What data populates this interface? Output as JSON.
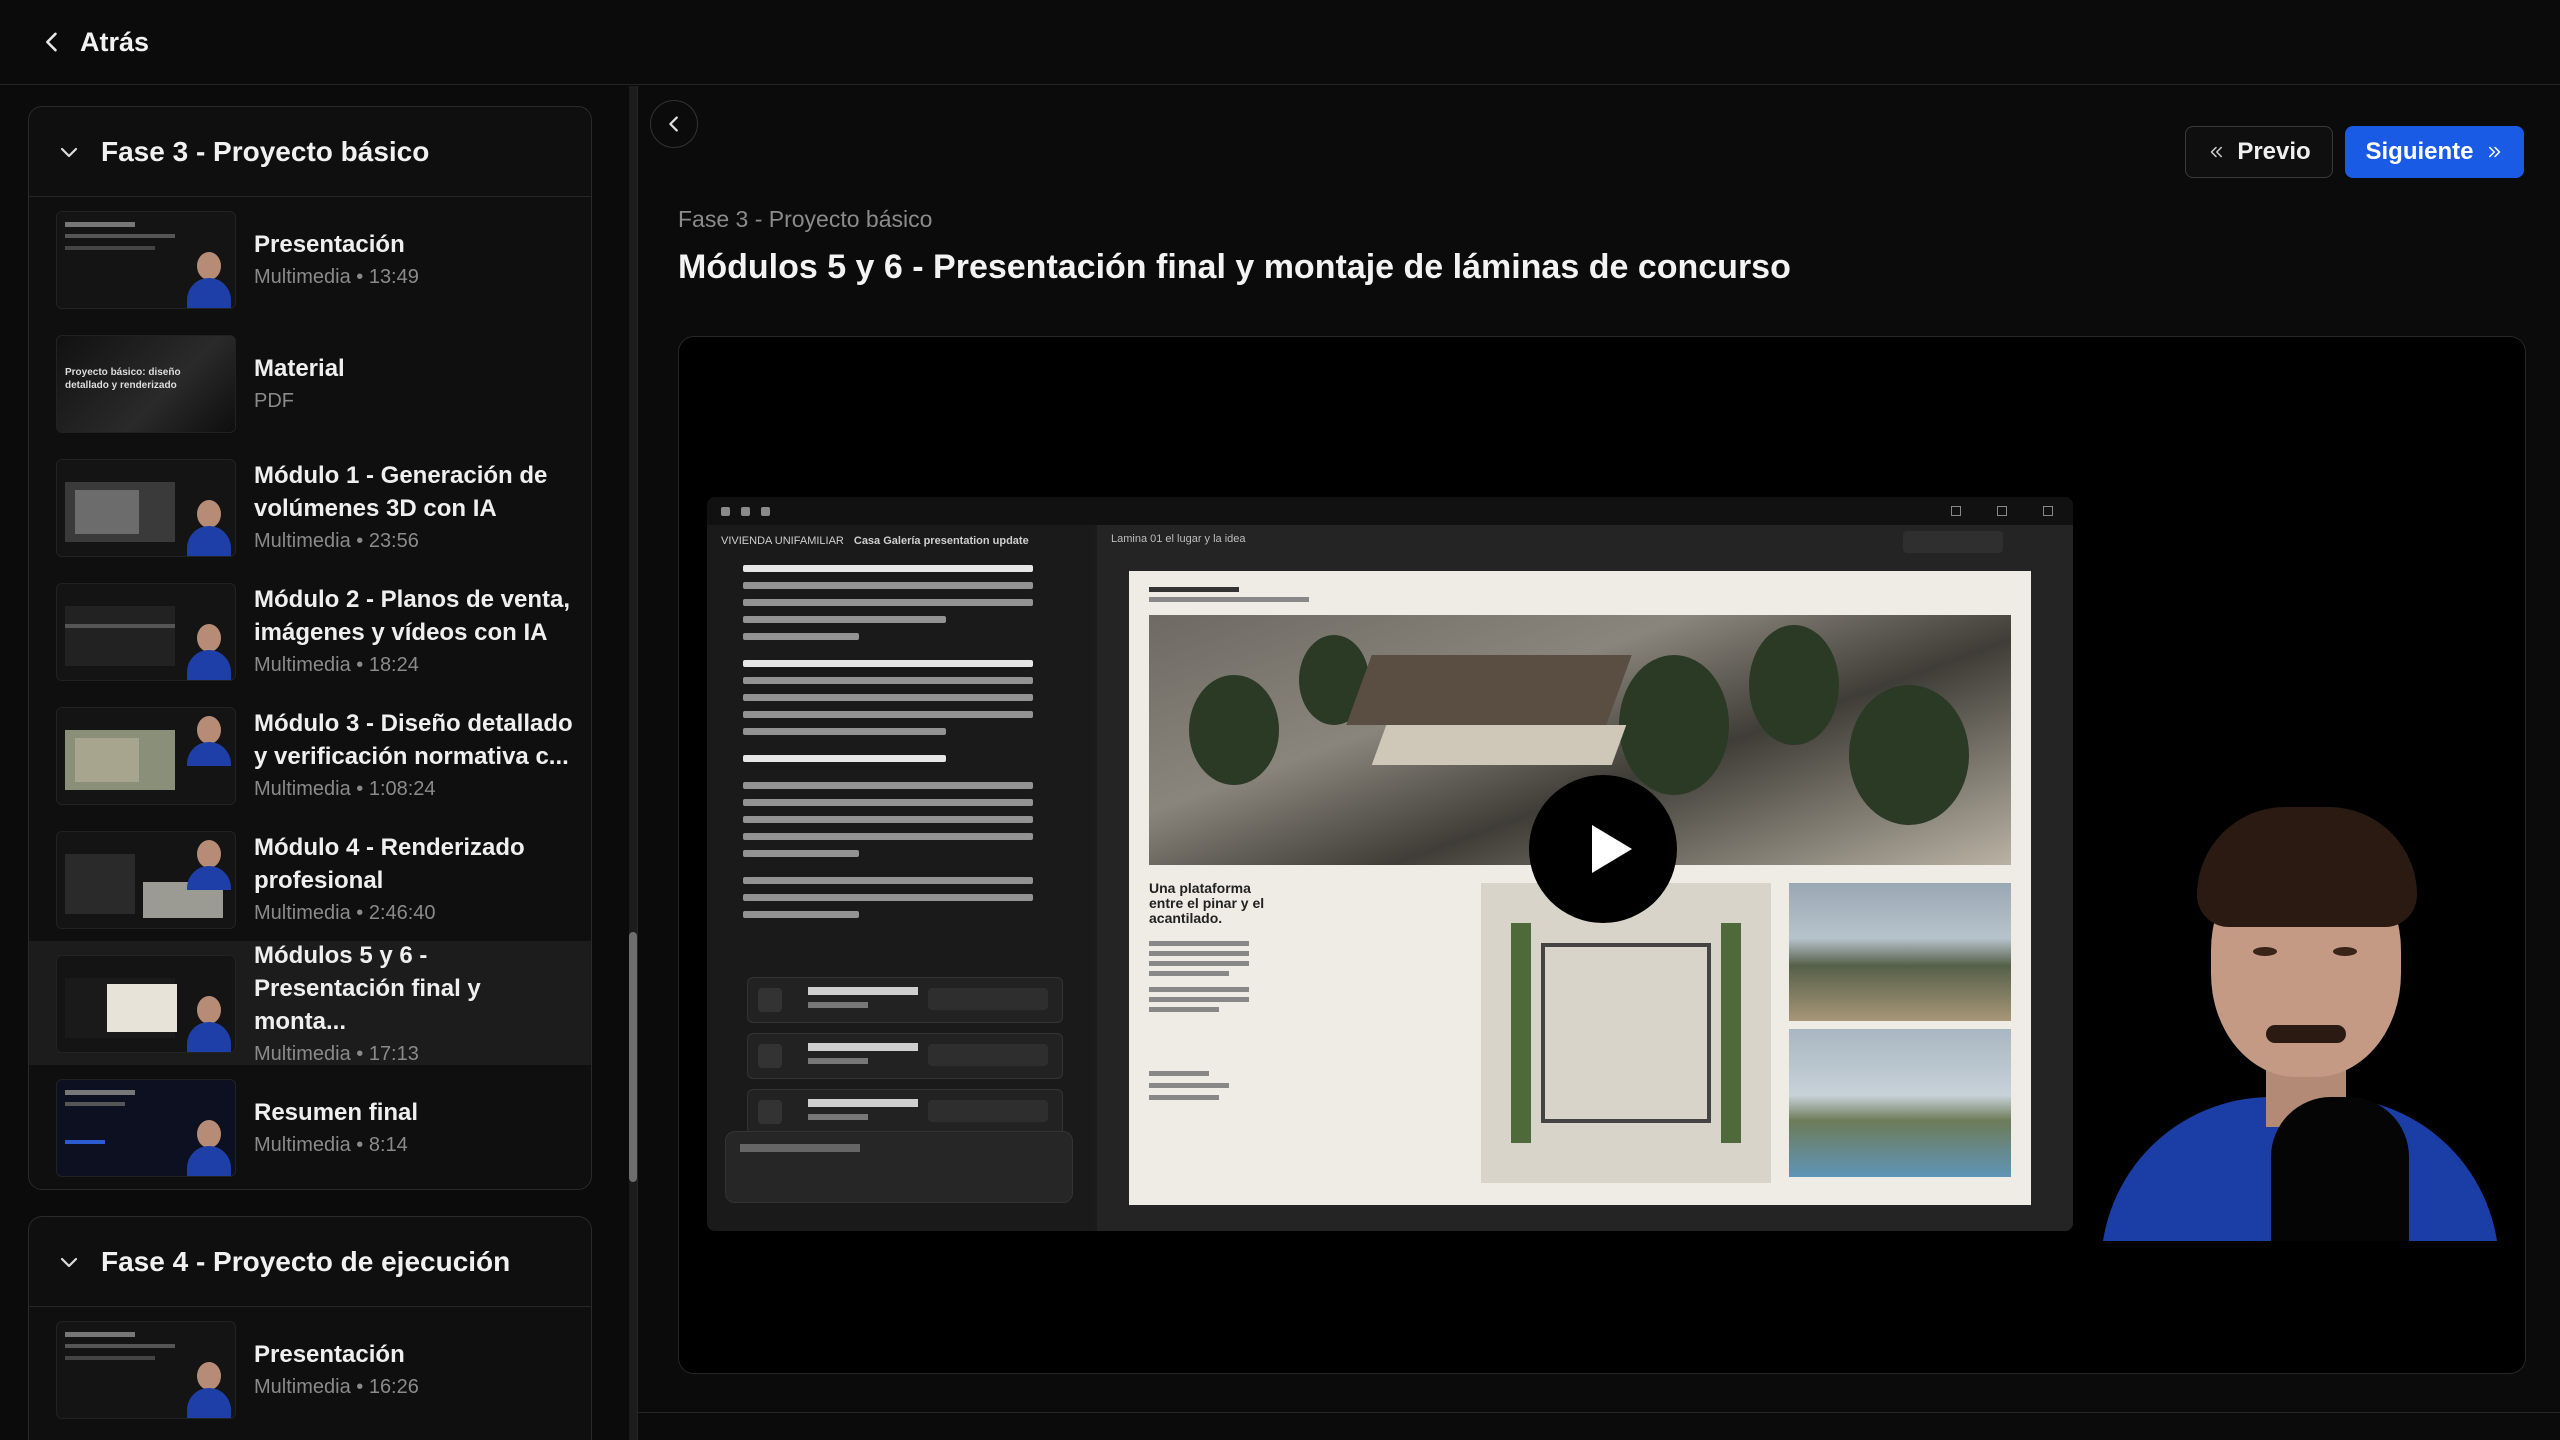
{
  "topbar": {
    "back_label": "Atrás"
  },
  "sidebar": {
    "sections": [
      {
        "title": "Fase 3 - Proyecto básico",
        "lessons": [
          {
            "title": "Presentación",
            "meta": "Multimedia • 13:49"
          },
          {
            "title": "Material",
            "meta": "PDF"
          },
          {
            "title": "Módulo 1 - Generación de volúmenes 3D con IA",
            "meta": "Multimedia • 23:56"
          },
          {
            "title": "Módulo 2 - Planos de venta, imágenes y vídeos con IA",
            "meta": "Multimedia • 18:24"
          },
          {
            "title": "Módulo 3 - Diseño detallado y verificación normativa c...",
            "meta": "Multimedia • 1:08:24"
          },
          {
            "title": "Módulo 4 - Renderizado profesional",
            "meta": "Multimedia • 2:46:40"
          },
          {
            "title": "Módulos 5 y 6 - Presentación final y monta...",
            "meta": "Multimedia • 17:13",
            "active": true
          },
          {
            "title": "Resumen final",
            "meta": "Multimedia • 8:14"
          }
        ]
      },
      {
        "title": "Fase 4 - Proyecto de ejecución",
        "lessons": [
          {
            "title": "Presentación",
            "meta": "Multimedia • 16:26"
          }
        ]
      }
    ],
    "thumb_labels": {
      "material": "Proyecto básico: diseño detallado y renderizado"
    }
  },
  "main": {
    "prev_label": "Previo",
    "next_label": "Siguiente",
    "breadcrumb": "Fase 3 - Proyecto básico",
    "title": "Módulos 5 y 6 - Presentación final y montaje de láminas de concurso"
  },
  "video": {
    "chat_header": "VIVIENDA UNIFAMILIAR",
    "chat_header_sub": "Casa Galería presentation update",
    "doc_header": "Lamina 01 el lugar y la idea",
    "sheet_heading": "Una plataforma entre el pinar y el acantilado."
  },
  "colors": {
    "accent": "#1a5be6",
    "background": "#0b0b0b",
    "active_row": "#1c1c1c"
  }
}
